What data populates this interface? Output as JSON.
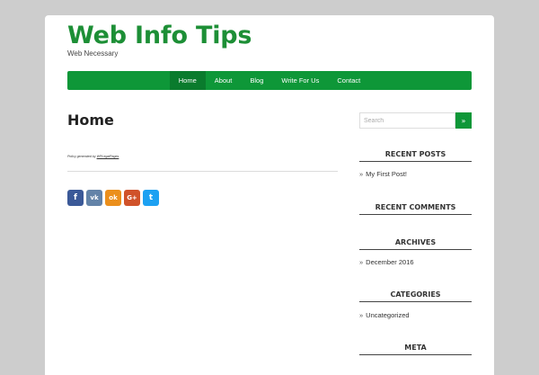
{
  "site": {
    "title": "Web Info Tips",
    "tagline": "Web Necessary"
  },
  "nav": {
    "items": [
      {
        "label": "Home",
        "active": true
      },
      {
        "label": "About"
      },
      {
        "label": "Blog"
      },
      {
        "label": "Write For Us"
      },
      {
        "label": "Contact"
      }
    ]
  },
  "main": {
    "page_title": "Home",
    "policy_prefix": "Policy generated by",
    "policy_link": "WPLegalPages",
    "share_buttons": [
      {
        "icon": "facebook-icon",
        "glyph": "f",
        "color": "#3b5998"
      },
      {
        "icon": "vk-icon",
        "glyph": "vk",
        "color": "#6383a8"
      },
      {
        "icon": "odnoklassniki-icon",
        "glyph": "ok",
        "color": "#eb8f1c"
      },
      {
        "icon": "google-plus-icon",
        "glyph": "G+",
        "color": "#d0522a"
      },
      {
        "icon": "twitter-icon",
        "glyph": "t",
        "color": "#1da1f2"
      }
    ]
  },
  "sidebar": {
    "search": {
      "placeholder": "Search",
      "button_glyph": "»"
    },
    "recent_posts": {
      "title": "RECENT POSTS",
      "items": [
        "My First Post!"
      ]
    },
    "recent_comments": {
      "title": "RECENT COMMENTS"
    },
    "archives": {
      "title": "ARCHIVES",
      "items": [
        "December 2016"
      ]
    },
    "categories": {
      "title": "CATEGORIES",
      "items": [
        "Uncategorized"
      ]
    },
    "meta": {
      "title": "META"
    },
    "bullet": "»"
  },
  "colors": {
    "accent": "#0e9738",
    "title_green": "#1d8f36",
    "background": "#cdcdcd"
  }
}
